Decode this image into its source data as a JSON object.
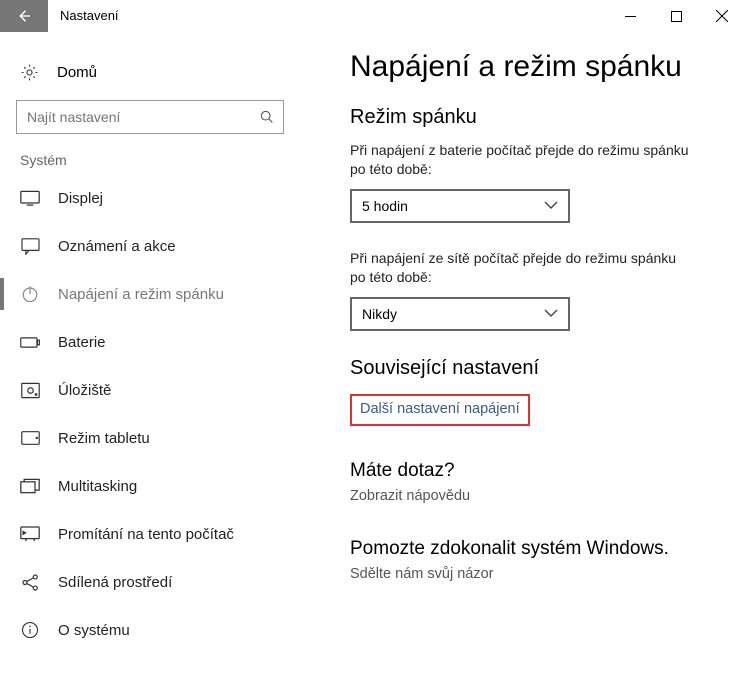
{
  "window": {
    "title": "Nastavení"
  },
  "sidebar": {
    "home": "Domů",
    "search_placeholder": "Najít nastavení",
    "section_label": "Systém",
    "items": [
      {
        "label": "Displej"
      },
      {
        "label": "Oznámení a akce"
      },
      {
        "label": "Napájení a režim spánku"
      },
      {
        "label": "Baterie"
      },
      {
        "label": "Úložiště"
      },
      {
        "label": "Režim tabletu"
      },
      {
        "label": "Multitasking"
      },
      {
        "label": "Promítání na tento počítač"
      },
      {
        "label": "Sdílená prostředí"
      },
      {
        "label": "O systému"
      }
    ]
  },
  "main": {
    "title": "Napájení a režim spánku",
    "sleep_heading": "Režim spánku",
    "battery_label": "Při napájení z baterie počítač přejde do režimu spánku po této době:",
    "battery_value": "5 hodin",
    "plugged_label": "Při napájení ze sítě počítač přejde do režimu spánku po této době:",
    "plugged_value": "Nikdy",
    "related_heading": "Související nastavení",
    "related_link": "Další nastavení napájení",
    "question_heading": "Máte dotaz?",
    "question_link": "Zobrazit nápovědu",
    "improve_heading": "Pomozte zdokonalit systém Windows.",
    "improve_link": "Sdělte nám svůj názor"
  }
}
